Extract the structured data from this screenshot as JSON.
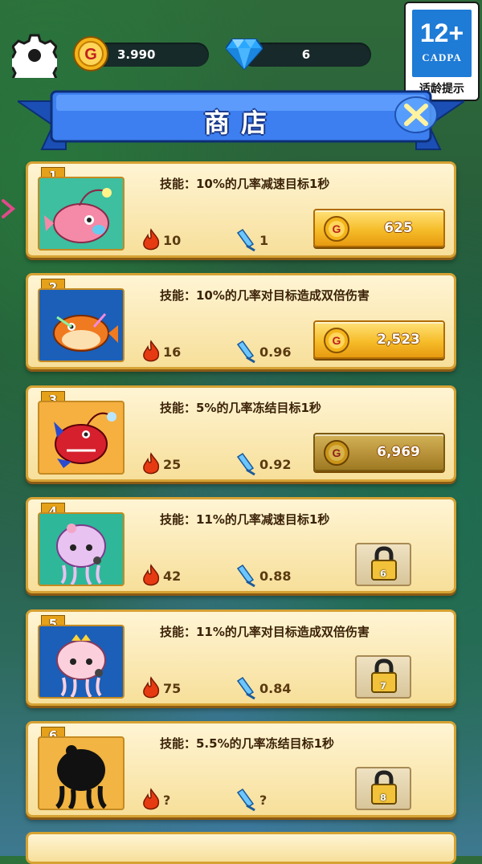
{
  "hud": {
    "gold": "3.990",
    "gems": "6"
  },
  "rating": {
    "age": "12+",
    "org": "CADPA",
    "tip": "适龄提示"
  },
  "title": "商店",
  "items": [
    {
      "num": "1",
      "skill": "技能：10%的几率减速目标1秒",
      "power": "10",
      "speed": "1",
      "price": "625",
      "state": "buy"
    },
    {
      "num": "2",
      "skill": "技能：10%的几率对目标造成双倍伤害",
      "power": "16",
      "speed": "0.96",
      "price": "2,523",
      "state": "buy"
    },
    {
      "num": "3",
      "skill": "技能：5%的几率冻结目标1秒",
      "power": "25",
      "speed": "0.92",
      "price": "6,969",
      "state": "dim"
    },
    {
      "num": "4",
      "skill": "技能：11%的几率减速目标1秒",
      "power": "42",
      "speed": "0.88",
      "lock_level": "6",
      "state": "locked"
    },
    {
      "num": "5",
      "skill": "技能：11%的几率对目标造成双倍伤害",
      "power": "75",
      "speed": "0.84",
      "lock_level": "7",
      "state": "locked"
    },
    {
      "num": "6",
      "skill": "技能：5.5%的几率冻结目标1秒",
      "power": "?",
      "speed": "?",
      "lock_level": "8",
      "state": "locked"
    }
  ],
  "colors": {
    "card_border": "#d6a233",
    "gold_button": "#f6bd2a",
    "banner_blue": "#2f6fe0"
  }
}
